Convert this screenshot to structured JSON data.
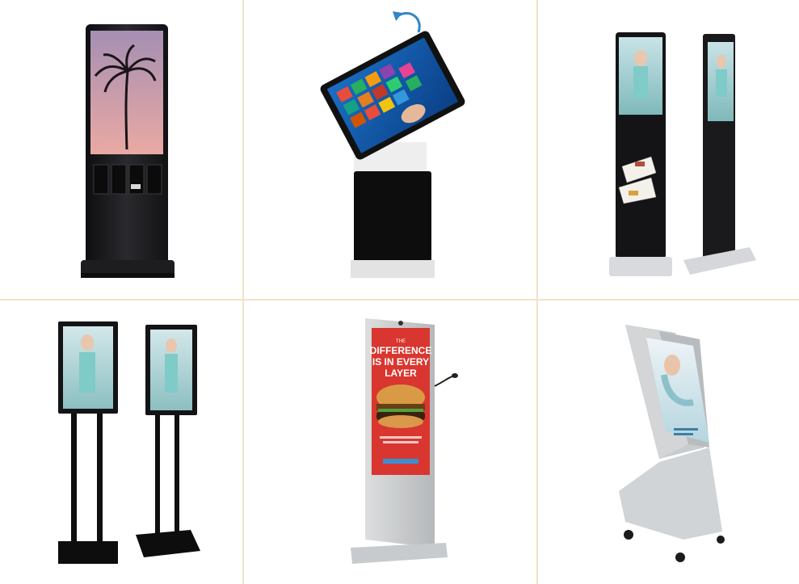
{
  "gallery": {
    "products": [
      {
        "name": "Kiosk with charging lockers"
      },
      {
        "name": "Rotating touchscreen kiosk"
      },
      {
        "name": "Floor standing poster display with brochure holder"
      },
      {
        "name": "Dual pole standing display"
      },
      {
        "name": "Outdoor advertising totem"
      },
      {
        "name": "Tilted kiosk display with wheels"
      }
    ],
    "ad_text": {
      "line1": "THE",
      "line2": "DIFFERENCE",
      "line3": "IS IN EVERY",
      "line4": "LAYER"
    }
  },
  "colors": {
    "divider": "#f1e2c9",
    "black_body": "#1b1b1d",
    "silver": "#d7d9db",
    "screen_sunset_top": "#a58fb3",
    "screen_sunset_bottom": "#e8a6a3",
    "burger_bg": "#d9362f",
    "kiosk_gray": "#c9ccce"
  }
}
